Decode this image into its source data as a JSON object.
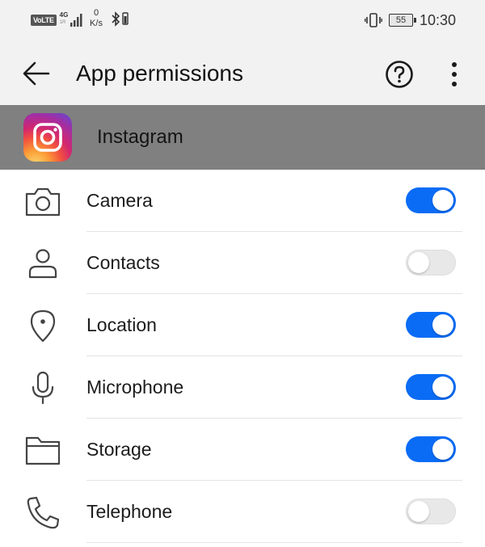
{
  "status_bar": {
    "volte": "VoLTE",
    "network": "4G",
    "network_sub": "1R",
    "speed_value": "0",
    "speed_unit": "K/s",
    "battery": "55",
    "time": "10:30"
  },
  "toolbar": {
    "title": "App permissions",
    "icons": [
      "back-arrow-icon",
      "help-icon",
      "more-vert-icon"
    ]
  },
  "app": {
    "name": "Instagram",
    "icon": "instagram-icon"
  },
  "permissions": [
    {
      "label": "Camera",
      "icon": "camera-icon",
      "enabled": true
    },
    {
      "label": "Contacts",
      "icon": "person-icon",
      "enabled": false
    },
    {
      "label": "Location",
      "icon": "location-pin-icon",
      "enabled": true
    },
    {
      "label": "Microphone",
      "icon": "microphone-icon",
      "enabled": true
    },
    {
      "label": "Storage",
      "icon": "folder-icon",
      "enabled": true
    },
    {
      "label": "Telephone",
      "icon": "phone-icon",
      "enabled": false
    }
  ],
  "colors": {
    "toggle_on": "#0a6cf5",
    "toggle_off": "#e8e8e8",
    "app_header_bg": "#808080",
    "toolbar_bg": "#f2f2f2"
  }
}
